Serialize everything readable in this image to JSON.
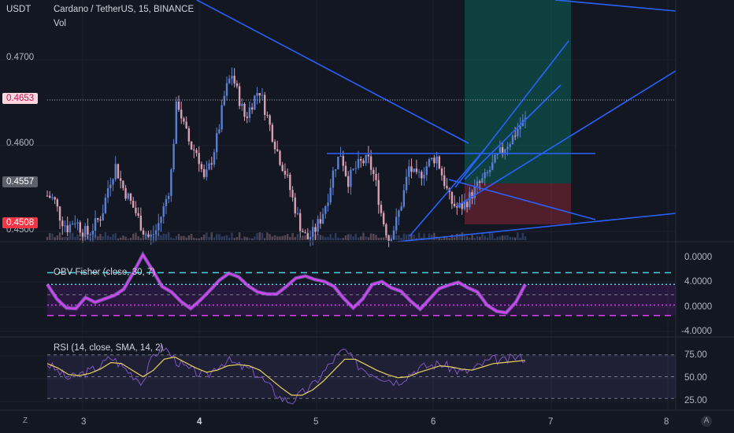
{
  "header": {
    "quote_currency": "USDT",
    "symbol": "Cardano / TetherUS, 15, BINANCE",
    "volume_label": "Vol"
  },
  "price_axis": {
    "ticks": [
      "0.4700",
      "0.4600",
      "0.4500"
    ]
  },
  "price_tags": {
    "current": {
      "text": "0.4653",
      "bg": "#ffd5de",
      "fg": "#c2185b"
    },
    "entry": {
      "text": "0.4557",
      "bg": "#5d606b",
      "fg": "#ffffff"
    },
    "stop": {
      "text": "0.4508",
      "bg": "#f23645",
      "fg": "#ffffff"
    }
  },
  "time_axis": {
    "labels": [
      "3",
      "4",
      "5",
      "6",
      "7",
      "8"
    ],
    "bold_label": "4"
  },
  "panes": {
    "obv": {
      "title": "OBV Fisher (close, 30, 7)",
      "ticks": [
        "0.0000",
        "4.0000",
        "0.0000",
        "-4.0000"
      ]
    },
    "rsi": {
      "title": "RSI (14, close, SMA, 14, 2)",
      "ticks": [
        "75.00",
        "50.00",
        "25.00"
      ]
    }
  },
  "corner": {
    "left": "Z",
    "right": "A"
  },
  "colors": {
    "up": "#5b7fcf",
    "down": "#d7a0b5",
    "trend": "#2962ff",
    "fisher": "#e040fb",
    "rsi": "#7e57c2",
    "rsi_ma": "#e6d45a",
    "target": "#089981",
    "stop": "#f23645"
  },
  "chart_data": [
    {
      "type": "candlestick",
      "title": "Cardano / TetherUS, 15, BINANCE",
      "x_ticks": [
        "3",
        "4",
        "5",
        "6",
        "7",
        "8"
      ],
      "ylim": [
        0.4492,
        0.4812
      ],
      "y_ticks": [
        0.47,
        0.46,
        0.45
      ],
      "series": [
        {
          "values": [
            0.4553,
            0.4548,
            0.4522,
            0.451,
            0.4522,
            0.4508,
            0.4502,
            0.4515,
            0.4528,
            0.4568,
            0.4592,
            0.4565,
            0.4548,
            0.453,
            0.4508,
            0.4496,
            0.4508,
            0.4535,
            0.4568,
            0.4682,
            0.4645,
            0.4618,
            0.461,
            0.4572,
            0.4598,
            0.4635,
            0.4688,
            0.4715,
            0.4684,
            0.4655,
            0.4676,
            0.4695,
            0.4664,
            0.4632,
            0.4603,
            0.458,
            0.4546,
            0.4514,
            0.4495,
            0.4504,
            0.4522,
            0.4548,
            0.459,
            0.461,
            0.4572,
            0.4588,
            0.4597,
            0.46,
            0.4575,
            0.4525,
            0.4496,
            0.4515,
            0.4548,
            0.4592,
            0.4575,
            0.4585,
            0.4598,
            0.4605,
            0.4575,
            0.4546,
            0.4537,
            0.454,
            0.4553,
            0.4566,
            0.4575,
            0.459,
            0.4605,
            0.4618,
            0.4628,
            0.4643,
            0.4653
          ]
        }
      ],
      "levels": {
        "current": 0.4653,
        "entry": 0.4557,
        "stop": 0.4508,
        "target": 0.479
      }
    },
    {
      "type": "line",
      "title": "OBV Fisher (close, 30, 7)",
      "x_ticks": [
        "3",
        "4",
        "5",
        "6",
        "7",
        "8"
      ],
      "ylim": [
        -5.2,
        6.2
      ],
      "y_ticks": [
        4.0,
        0.0,
        -4.0
      ],
      "series": [
        {
          "values": [
            1.5,
            -0.6,
            -1.9,
            -2.0,
            -0.4,
            -1.1,
            -0.6,
            -0.1,
            0.8,
            3.2,
            5.8,
            3.6,
            1.2,
            0.4,
            -1.0,
            -2.0,
            -0.8,
            0.6,
            2.1,
            3.1,
            2.6,
            1.3,
            0.4,
            0.1,
            0.1,
            1.2,
            2.4,
            2.7,
            2.2,
            1.9,
            1.2,
            -0.5,
            -1.9,
            -0.6,
            1.5,
            1.9,
            1.0,
            0.5,
            -0.9,
            -2.1,
            -0.6,
            0.9,
            1.4,
            1.8,
            1.0,
            0.4,
            -1.5,
            -2.4,
            -2.6,
            -1.1,
            1.5
          ]
        }
      ]
    },
    {
      "type": "line",
      "title": "RSI (14, close, SMA, 14, 2)",
      "x_ticks": [
        "3",
        "4",
        "5",
        "6",
        "7",
        "8"
      ],
      "ylim": [
        20,
        85
      ],
      "y_ticks": [
        75,
        50,
        25
      ],
      "series": [
        {
          "values": [
            62,
            55,
            48,
            52,
            55,
            60,
            68,
            60,
            52,
            45,
            70,
            77,
            66,
            58,
            54,
            50,
            60,
            65,
            60,
            57,
            50,
            40,
            30,
            27,
            35,
            42,
            54,
            66,
            75,
            62,
            56,
            52,
            48,
            45,
            52,
            58,
            60,
            62,
            58,
            54,
            56,
            62,
            66,
            64,
            68,
            67
          ]
        },
        {
          "values": [
            62,
            58,
            52,
            51,
            53,
            57,
            63,
            62,
            56,
            50,
            56,
            66,
            68,
            63,
            58,
            54,
            56,
            60,
            61,
            60,
            56,
            48,
            40,
            33,
            33,
            38,
            46,
            56,
            66,
            66,
            61,
            56,
            52,
            49,
            50,
            54,
            57,
            60,
            59,
            57,
            56,
            59,
            62,
            63,
            64,
            65
          ]
        }
      ]
    }
  ]
}
